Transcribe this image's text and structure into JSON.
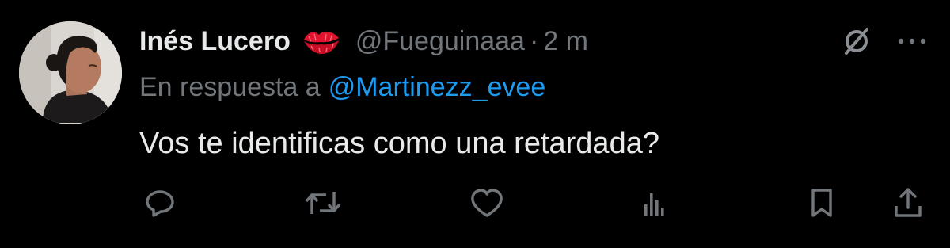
{
  "tweet": {
    "author": {
      "display_name": "Inés Lucero",
      "emoji_icon": "kiss-mark-icon",
      "handle": "@Fueguinaaa",
      "separator": "·",
      "time": "2 m"
    },
    "reply": {
      "prefix": "En respuesta a",
      "target": "@Martinezz_evee"
    },
    "text": "Vos te identificas como una retardada?",
    "actions": [
      "reply-icon",
      "retweet-icon",
      "like-icon",
      "views-icon",
      "bookmark-icon",
      "share-icon"
    ],
    "header_icons": [
      "grok-icon",
      "more-icon"
    ]
  },
  "colors": {
    "background": "#000000",
    "primary_text": "#e7e9ea",
    "secondary_text": "#71767b",
    "link": "#1d9bf0",
    "kiss_mark": "#e0142c"
  }
}
